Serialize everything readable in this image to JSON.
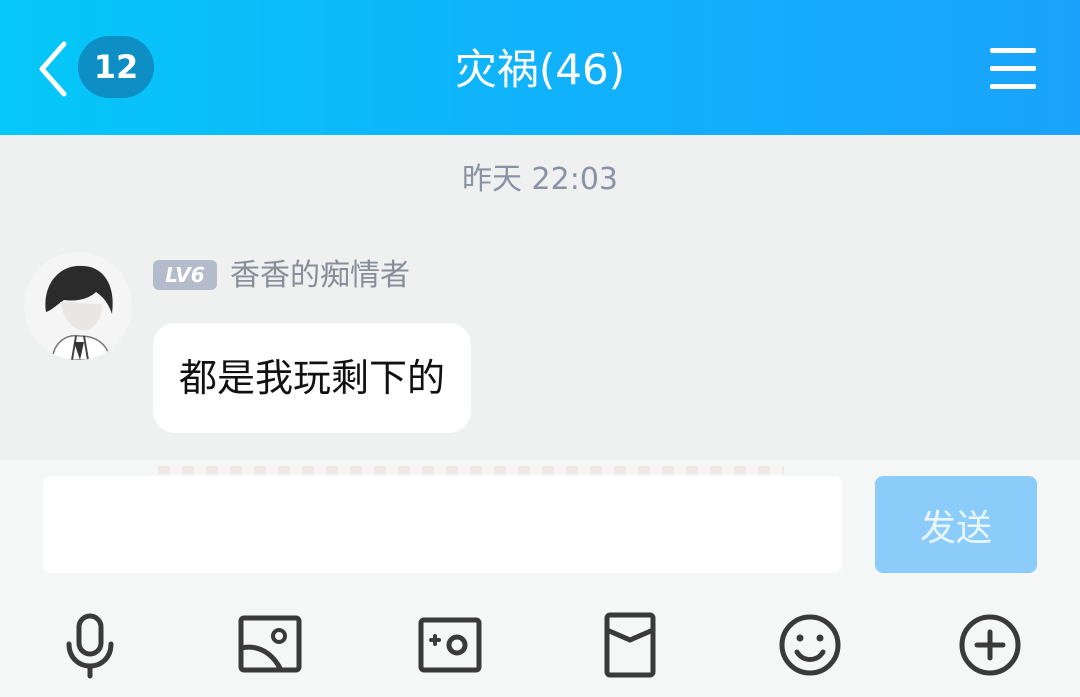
{
  "header": {
    "unread_count": "12",
    "title": "灾祸(46)"
  },
  "chat": {
    "timestamp": "昨天 22:03",
    "messages": [
      {
        "level": "LV6",
        "sender": "香香的痴情者",
        "text": "都是我玩剩下的"
      }
    ]
  },
  "input": {
    "value": "",
    "send_label": "发送"
  },
  "toolbar": {
    "icons": [
      "microphone-icon",
      "image-icon",
      "camera-icon",
      "red-packet-icon",
      "emoji-icon",
      "add-icon"
    ]
  },
  "colors": {
    "header_start": "#05c8f8",
    "header_end": "#1aa3fc",
    "send_button": "#8bccfb",
    "background": "#eef1f0"
  }
}
